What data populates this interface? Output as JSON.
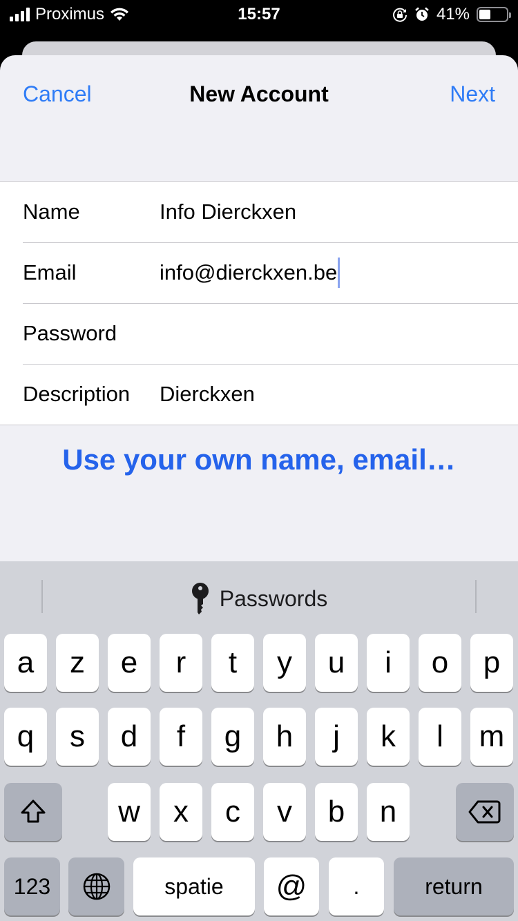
{
  "status_bar": {
    "carrier": "Proximus",
    "time": "15:57",
    "battery_percent_label": "41%",
    "battery_level": 0.41,
    "icons": [
      "signal-icon",
      "wifi-icon",
      "rotation-lock-icon",
      "alarm-icon",
      "battery-icon"
    ]
  },
  "nav": {
    "cancel_label": "Cancel",
    "title": "New Account",
    "next_label": "Next"
  },
  "form": {
    "fields": [
      {
        "label": "Name",
        "value": "Info Dierckxen"
      },
      {
        "label": "Email",
        "value": "info@dierckxen.be"
      },
      {
        "label": "Password",
        "value": ""
      },
      {
        "label": "Description",
        "value": "Dierckxen"
      }
    ]
  },
  "promo_text": "Use your own name, email…",
  "colors": {
    "accent": "#2f7cf6",
    "promo": "#2563eb",
    "background": "#f0f0f5",
    "keyboard": "#d1d3d9"
  },
  "keyboard": {
    "suggestion_label": "Passwords",
    "row1": [
      "a",
      "z",
      "e",
      "r",
      "t",
      "y",
      "u",
      "i",
      "o",
      "p"
    ],
    "row2": [
      "q",
      "s",
      "d",
      "f",
      "g",
      "h",
      "j",
      "k",
      "l",
      "m"
    ],
    "row3": [
      "w",
      "x",
      "c",
      "v",
      "b",
      "n"
    ],
    "numbers_label": "123",
    "space_label": "spatie",
    "at_label": "@",
    "dot_label": ".",
    "return_label": "return"
  }
}
